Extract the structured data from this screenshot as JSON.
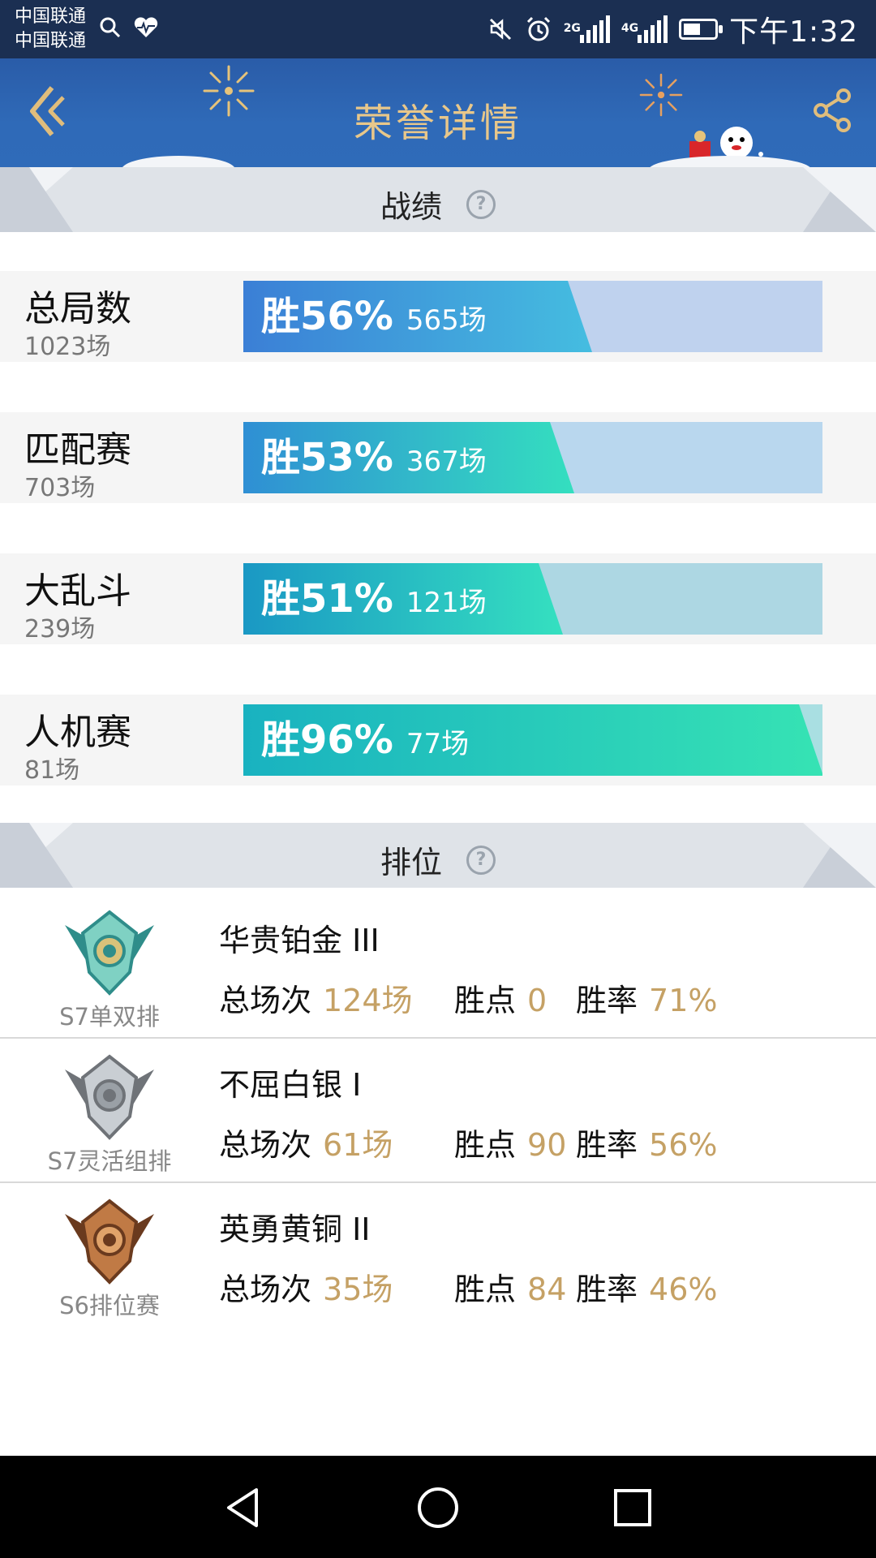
{
  "status_bar": {
    "carrier_1": "中国联通",
    "carrier_2": "中国联通",
    "network_1": "2G",
    "network_2": "4G",
    "time": "下午1:32",
    "battery_level": 0.55
  },
  "header": {
    "title": "荣誉详情"
  },
  "stats_section": {
    "title": "战绩",
    "help": "?",
    "rows": [
      {
        "name": "总局数",
        "total": "1023场",
        "win_label": "胜56%",
        "win_count": "565场",
        "win_rate": 0.56,
        "fill_from": "#3b7fd6",
        "fill_to": "#45bde0",
        "track": "#bfd2ee"
      },
      {
        "name": "匹配赛",
        "total": "703场",
        "win_label": "胜53%",
        "win_count": "367场",
        "win_rate": 0.53,
        "fill_from": "#2f8fd4",
        "fill_to": "#34dfbf",
        "track": "#b9d7ee"
      },
      {
        "name": "大乱斗",
        "total": "239场",
        "win_label": "胜51%",
        "win_count": "121场",
        "win_rate": 0.51,
        "fill_from": "#1a98c4",
        "fill_to": "#35e0c0",
        "track": "#add7e3"
      },
      {
        "name": "人机赛",
        "total": "81场",
        "win_label": "胜96%",
        "win_count": "77场",
        "win_rate": 0.96,
        "fill_from": "#19b2c0",
        "fill_to": "#36e3b4",
        "track": "#a9dfe2"
      }
    ]
  },
  "rank_section": {
    "title": "排位",
    "help": "?",
    "rows": [
      {
        "season": "S7单双排",
        "tier": "华贵铂金 III",
        "label_games": "总场次",
        "games": "124场",
        "label_points": "胜点",
        "points": "0",
        "label_rate": "胜率",
        "rate": "71%",
        "emblem": "platinum-emblem-icon"
      },
      {
        "season": "S7灵活组排",
        "tier": "不屈白银 I",
        "label_games": "总场次",
        "games": "61场",
        "label_points": "胜点",
        "points": "90",
        "label_rate": "胜率",
        "rate": "56%",
        "emblem": "silver-emblem-icon"
      },
      {
        "season": "S6排位赛",
        "tier": "英勇黄铜 II",
        "label_games": "总场次",
        "games": "35场",
        "label_points": "胜点",
        "points": "84",
        "label_rate": "胜率",
        "rate": "46%",
        "emblem": "bronze-emblem-icon"
      }
    ]
  },
  "colors": {
    "header_bg": "#2f6ab8",
    "title_gold": "#e8c78a",
    "stat_value_gold": "#c5a165"
  }
}
